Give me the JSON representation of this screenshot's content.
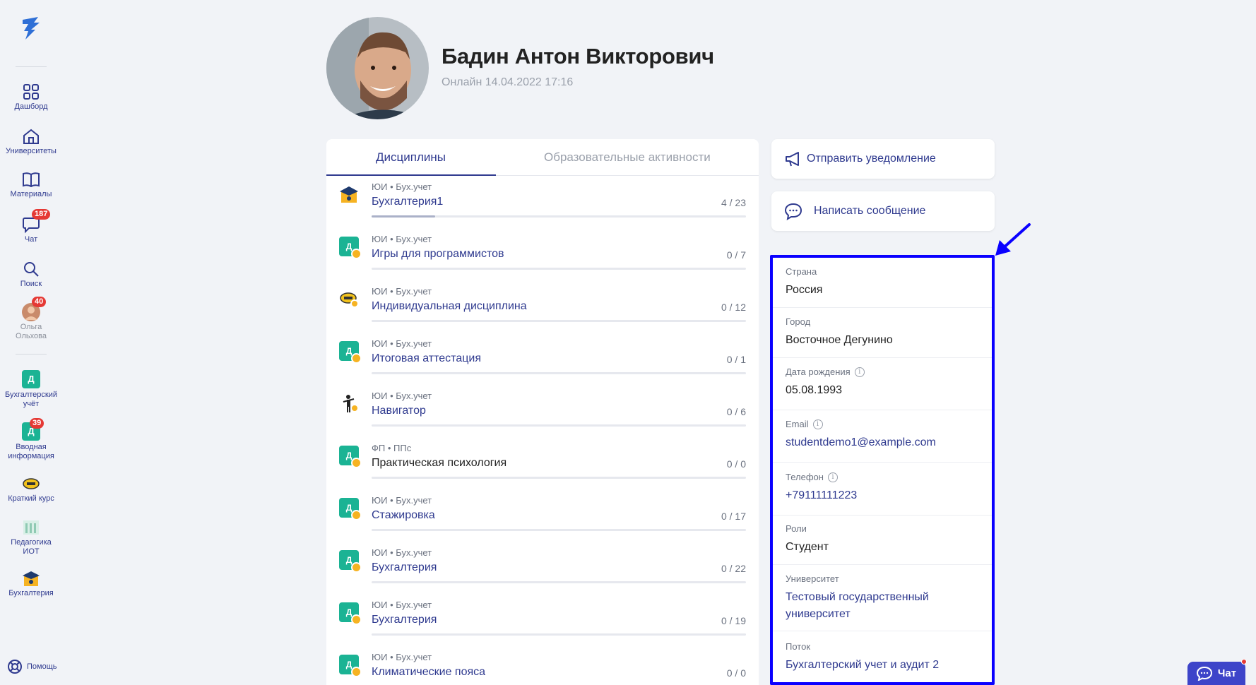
{
  "sidebar": {
    "items": [
      {
        "label": "Дашборд",
        "icon": "grid-icon"
      },
      {
        "label": "Университеты",
        "icon": "home-icon"
      },
      {
        "label": "Материалы",
        "icon": "book-icon"
      },
      {
        "label": "Чат",
        "icon": "chat-icon",
        "badge": "187"
      },
      {
        "label": "Поиск",
        "icon": "search-icon"
      },
      {
        "label": "Ольга Ольхова",
        "icon": "avatar",
        "badge": "40"
      }
    ],
    "courses": [
      {
        "label": "Бухгалтерский учёт",
        "letter": "Д"
      },
      {
        "label": "Вводная информация",
        "letter": "Д",
        "badge": "39"
      },
      {
        "label": "Краткий курс",
        "icon": "yellow-badge-icon"
      },
      {
        "label": "Педагогика ИОТ",
        "icon": "building-icon"
      },
      {
        "label": "Бухгалтерия",
        "icon": "graduation-cap-icon"
      }
    ],
    "help": "Помощь"
  },
  "profile": {
    "name": "Бадин Антон Викторович",
    "status": "Онлайн 14.04.2022 17:16"
  },
  "tabs": {
    "active": "Дисциплины",
    "inactive": "Образовательные активности"
  },
  "disciplines": [
    {
      "org": "ЮИ",
      "group": "Бух.учет",
      "title": "Бухгалтерия1",
      "count": "4 / 23",
      "progress": 0.17,
      "icon": "graduation-cap-icon"
    },
    {
      "org": "ЮИ",
      "group": "Бух.учет",
      "title": "Игры для программистов",
      "count": "0 / 7",
      "progress": 0,
      "icon": "d-icon"
    },
    {
      "org": "ЮИ",
      "group": "Бух.учет",
      "title": "Индивидуальная дисциплина",
      "count": "0 / 12",
      "progress": 0,
      "icon": "yellow-badge-icon"
    },
    {
      "org": "ЮИ",
      "group": "Бух.учет",
      "title": "Итоговая аттестация",
      "count": "0 / 1",
      "progress": 0,
      "icon": "d-icon"
    },
    {
      "org": "ЮИ",
      "group": "Бух.учет",
      "title": "Навигатор",
      "count": "0 / 6",
      "progress": 0,
      "icon": "person-icon"
    },
    {
      "org": "ФП",
      "group": "ППс",
      "title": "Практическая психология",
      "count": "0 / 0",
      "progress": 0,
      "icon": "d-icon"
    },
    {
      "org": "ЮИ",
      "group": "Бух.учет",
      "title": "Стажировка",
      "count": "0 / 17",
      "progress": 0,
      "icon": "d-icon"
    },
    {
      "org": "ЮИ",
      "group": "Бух.учет",
      "title": "Бухгалтерия",
      "count": "0 / 22",
      "progress": 0,
      "icon": "d-icon"
    },
    {
      "org": "ЮИ",
      "group": "Бух.учет",
      "title": "Бухгалтерия",
      "count": "0 / 19",
      "progress": 0,
      "icon": "d-icon"
    },
    {
      "org": "ЮИ",
      "group": "Бух.учет",
      "title": "Климатические пояса",
      "count": "0 / 0",
      "progress": 0,
      "icon": "d-icon"
    }
  ],
  "actions": {
    "notify": "Отправить уведомление",
    "message": "Написать сообщение"
  },
  "info": {
    "country_label": "Страна",
    "country": "Россия",
    "city_label": "Город",
    "city": "Восточное Дегунино",
    "birth_label": "Дата рождения",
    "birth": "05.08.1993",
    "email_label": "Email",
    "email": "studentdemo1@example.com",
    "phone_label": "Телефон",
    "phone": "+79111111223",
    "roles_label": "Роли",
    "roles": "Студент",
    "university_label": "Университет",
    "university": "Тестовый государственный университет",
    "stream_label": "Поток",
    "stream": "Бухгалтерский учет и аудит 2"
  },
  "chat_button": "Чат",
  "colors": {
    "accent": "#2f3a8f",
    "highlight": "#0a00ff",
    "green": "#1bb394",
    "badge": "#e53935"
  }
}
